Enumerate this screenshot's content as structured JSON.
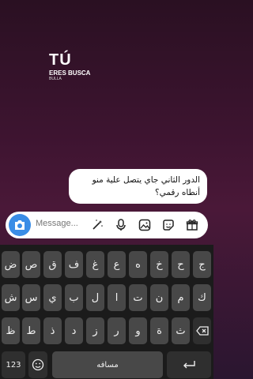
{
  "logo": {
    "title": "TÚ",
    "subtitle": "ERES BUSCA",
    "tag": "BULLA"
  },
  "message": {
    "text": "الدور الثاني جاي يتصل علية منو أنطاه رقمي؟"
  },
  "composer": {
    "placeholder": "Message...",
    "icons": [
      "camera-icon",
      "magic-wand-icon",
      "microphone-icon",
      "image-icon",
      "sticker-icon",
      "gift-icon"
    ],
    "accent": "#3a8de6"
  },
  "keyboard": {
    "row1": [
      "ض",
      "ص",
      "ق",
      "ف",
      "غ",
      "ع",
      "ه",
      "خ",
      "ح",
      "ج"
    ],
    "row2": [
      "ش",
      "س",
      "ي",
      "ب",
      "ل",
      "ا",
      "ت",
      "ن",
      "م",
      "ك"
    ],
    "row3": [
      "ظ",
      "ط",
      "ذ",
      "د",
      "ز",
      "ر",
      "و",
      "ة",
      "ث"
    ],
    "numbers_key": "123",
    "space_label": "مسافه",
    "icons": [
      "backspace-icon",
      "emoji-icon",
      "enter-icon"
    ]
  }
}
